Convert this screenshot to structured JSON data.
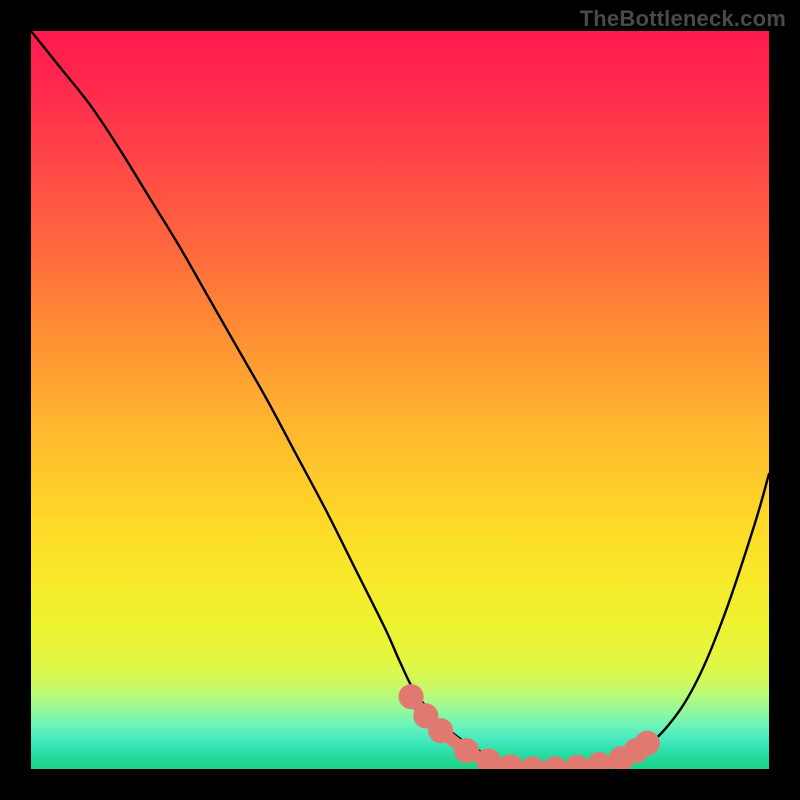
{
  "watermark": {
    "text": "TheBottleneck.com"
  },
  "colors": {
    "gradient_top": "#ff1a4d",
    "gradient_mid": "#ffd828",
    "gradient_bottom": "#18d487",
    "curve": "#000000",
    "highlight": "#e07a70",
    "frame": "#000000"
  },
  "chart_data": {
    "type": "line",
    "title": "",
    "xlabel": "",
    "ylabel": "",
    "xlim": [
      0,
      100
    ],
    "ylim": [
      0,
      100
    ],
    "series": [
      {
        "name": "bottleneck-curve",
        "x": [
          0,
          4,
          8,
          12,
          16,
          20,
          24,
          28,
          32,
          36,
          40,
          44,
          48,
          50,
          52,
          55,
          58,
          61,
          64,
          67,
          70,
          74,
          78,
          82,
          86,
          90,
          94,
          98,
          100
        ],
        "y": [
          100,
          95,
          90,
          84,
          77.5,
          71,
          64,
          57,
          50,
          42.5,
          35,
          27,
          19,
          14.5,
          10.5,
          6.8,
          4.2,
          2.3,
          1.0,
          0.3,
          0.0,
          0.1,
          0.6,
          2.2,
          5.5,
          11.5,
          21,
          33,
          40
        ]
      }
    ],
    "highlight_segment": {
      "name": "optimal-range",
      "points": [
        {
          "x": 51.5,
          "y": 9.8
        },
        {
          "x": 53.5,
          "y": 7.2
        },
        {
          "x": 55.5,
          "y": 5.2
        },
        {
          "x": 59,
          "y": 2.5
        },
        {
          "x": 62,
          "y": 1.1
        },
        {
          "x": 65,
          "y": 0.3
        },
        {
          "x": 68,
          "y": 0.0
        },
        {
          "x": 71,
          "y": 0.0
        },
        {
          "x": 74,
          "y": 0.2
        },
        {
          "x": 77,
          "y": 0.6
        },
        {
          "x": 80,
          "y": 1.4
        },
        {
          "x": 82,
          "y": 2.5
        },
        {
          "x": 83.5,
          "y": 3.5
        }
      ],
      "marker_radius": 1.7
    }
  }
}
